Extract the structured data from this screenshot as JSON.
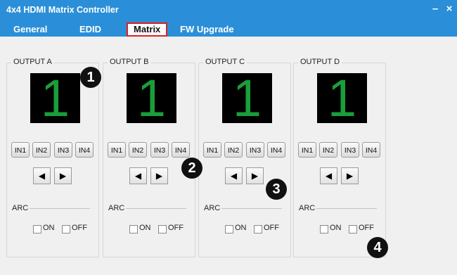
{
  "window": {
    "title": "4x4 HDMI Matrix Controller",
    "minimize_glyph": "–",
    "close_glyph": "×"
  },
  "tabs": [
    {
      "label": "General",
      "active": false
    },
    {
      "label": "EDID",
      "active": false
    },
    {
      "label": "Matrix",
      "active": true
    },
    {
      "label": "FW Upgrade",
      "active": false
    }
  ],
  "outputs": [
    {
      "label": "OUTPUT A",
      "display": "1",
      "inputs": [
        "IN1",
        "IN2",
        "IN3",
        "IN4"
      ],
      "arc_label": "ARC",
      "arc_on": "ON",
      "arc_off": "OFF"
    },
    {
      "label": "OUTPUT B",
      "display": "1",
      "inputs": [
        "IN1",
        "IN2",
        "IN3",
        "IN4"
      ],
      "arc_label": "ARC",
      "arc_on": "ON",
      "arc_off": "OFF"
    },
    {
      "label": "OUTPUT C",
      "display": "1",
      "inputs": [
        "IN1",
        "IN2",
        "IN3",
        "IN4"
      ],
      "arc_label": "ARC",
      "arc_on": "ON",
      "arc_off": "OFF"
    },
    {
      "label": "OUTPUT D",
      "display": "1",
      "inputs": [
        "IN1",
        "IN2",
        "IN3",
        "IN4"
      ],
      "arc_label": "ARC",
      "arc_on": "ON",
      "arc_off": "OFF"
    }
  ],
  "callouts": [
    "1",
    "2",
    "3",
    "4"
  ],
  "colors": {
    "header": "#2a8fd8",
    "display_bg": "#000000",
    "display_digit": "#1a9e3a",
    "active_tab_border": "#e02020"
  },
  "icons": {
    "prev": "left-arrow-icon",
    "next": "right-arrow-icon"
  }
}
